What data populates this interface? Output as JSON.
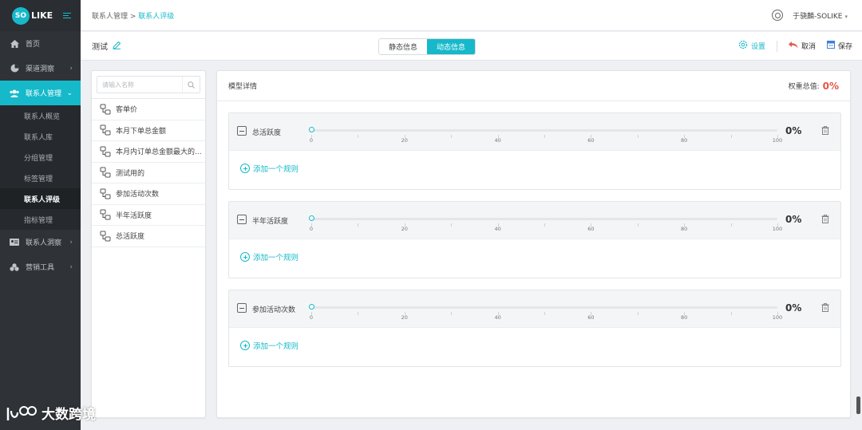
{
  "app": {
    "logo_so": "SO",
    "logo_like": "LIKE"
  },
  "sidebar": {
    "items": [
      {
        "label": "首页",
        "icon": "home-icon"
      },
      {
        "label": "渠道洞察",
        "icon": "pie-chart-icon"
      },
      {
        "label": "联系人管理",
        "icon": "users-icon",
        "active": true
      },
      {
        "label": "联系人洞察",
        "icon": "id-card-icon"
      },
      {
        "label": "营销工具",
        "icon": "tools-icon"
      }
    ],
    "sub_items": [
      "联系人概览",
      "联系人库",
      "分组管理",
      "标签管理",
      "联系人评级",
      "指标管理"
    ]
  },
  "topbar": {
    "breadcrumb_parent": "联系人管理 > ",
    "breadcrumb_current": "联系人评级",
    "user_name": "于骁麟-SOLIKE",
    "caret": "▾"
  },
  "toolbar": {
    "project_name": "测试",
    "tab_static": "静态信息",
    "tab_dynamic": "动态信息",
    "settings_label": "设置",
    "cancel_label": "取消",
    "save_label": "保存"
  },
  "indicator_list": {
    "search_placeholder": "请输入名称",
    "items": [
      "客单价",
      "本月下单总金额",
      "本月内订单总金额最大的...",
      "测试用的",
      "参加活动次数",
      "半年活跃度",
      "总活跃度"
    ]
  },
  "model": {
    "title": "模型详情",
    "weight_total_label": "权重总值:",
    "weight_total_value": "0%",
    "tick_labels": [
      "0",
      "20",
      "40",
      "60",
      "80",
      "100"
    ],
    "add_rule_label": "添加一个规则",
    "blocks": [
      {
        "name": "总活跃度",
        "percent": "0%",
        "weight": 0
      },
      {
        "name": "半年活跃度",
        "percent": "0%",
        "weight": 0
      },
      {
        "name": "参加活动次数",
        "percent": "0%",
        "weight": 0
      }
    ]
  },
  "watermark": {
    "text": "大数跨境"
  },
  "colors": {
    "accent": "#16b9c9",
    "sidebar_bg": "#2f3236",
    "danger": "#e2574c"
  }
}
